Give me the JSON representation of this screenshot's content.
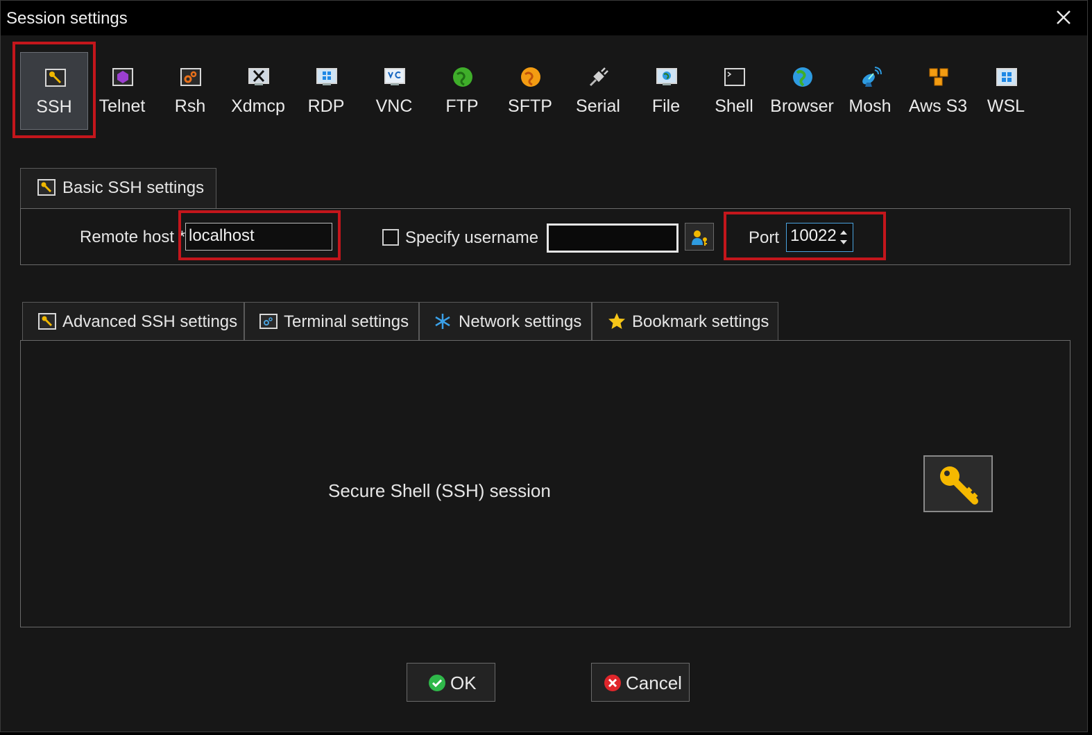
{
  "window": {
    "title": "Session settings"
  },
  "session_types": [
    {
      "label": "SSH",
      "icon": "ssh-key-icon",
      "selected": true
    },
    {
      "label": "Telnet",
      "icon": "telnet-icon"
    },
    {
      "label": "Rsh",
      "icon": "rsh-icon"
    },
    {
      "label": "Xdmcp",
      "icon": "xdmcp-icon"
    },
    {
      "label": "RDP",
      "icon": "rdp-icon"
    },
    {
      "label": "VNC",
      "icon": "vnc-icon"
    },
    {
      "label": "FTP",
      "icon": "ftp-globe-icon"
    },
    {
      "label": "SFTP",
      "icon": "sftp-globe-icon"
    },
    {
      "label": "Serial",
      "icon": "serial-plug-icon"
    },
    {
      "label": "File",
      "icon": "file-monitor-icon"
    },
    {
      "label": "Shell",
      "icon": "shell-terminal-icon"
    },
    {
      "label": "Browser",
      "icon": "browser-globe-icon"
    },
    {
      "label": "Mosh",
      "icon": "mosh-satellite-icon"
    },
    {
      "label": "Aws S3",
      "icon": "aws-s3-cubes-icon"
    },
    {
      "label": "WSL",
      "icon": "wsl-windows-icon"
    }
  ],
  "basic": {
    "tab_label": "Basic SSH settings",
    "remote_host_label": "Remote host *",
    "remote_host_value": "localhost",
    "specify_username_label": "Specify username",
    "username_value": "",
    "port_label": "Port",
    "port_value": "10022"
  },
  "tabs": [
    {
      "label": "Advanced SSH settings",
      "icon": "key-icon"
    },
    {
      "label": "Terminal settings",
      "icon": "terminal-icon"
    },
    {
      "label": "Network settings",
      "icon": "network-star-icon"
    },
    {
      "label": "Bookmark settings",
      "icon": "star-icon"
    }
  ],
  "main": {
    "description": "Secure Shell (SSH) session"
  },
  "buttons": {
    "ok": "OK",
    "cancel": "Cancel"
  },
  "colors": {
    "highlight": "#c4161c",
    "background": "#171717",
    "titlebar": "#000000"
  }
}
